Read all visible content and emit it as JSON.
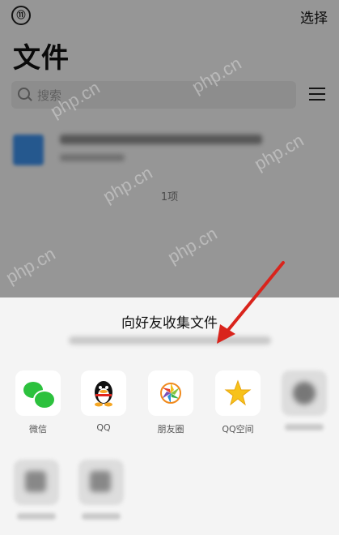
{
  "header": {
    "history_icon_label": "⑪",
    "select_label": "选择",
    "title": "文件"
  },
  "search": {
    "placeholder": "搜索"
  },
  "file_list": {
    "count_label": "1项"
  },
  "sheet": {
    "title": "向好友收集文件",
    "share_targets": [
      {
        "label": "微信",
        "icon": "wechat-icon"
      },
      {
        "label": "QQ",
        "icon": "qq-penguin-icon"
      },
      {
        "label": "朋友圈",
        "icon": "moments-icon"
      },
      {
        "label": "QQ空间",
        "icon": "qzone-star-icon"
      }
    ]
  },
  "watermark": {
    "text": "php.cn"
  },
  "annotation": {
    "arrow_color": "#d9241c"
  }
}
